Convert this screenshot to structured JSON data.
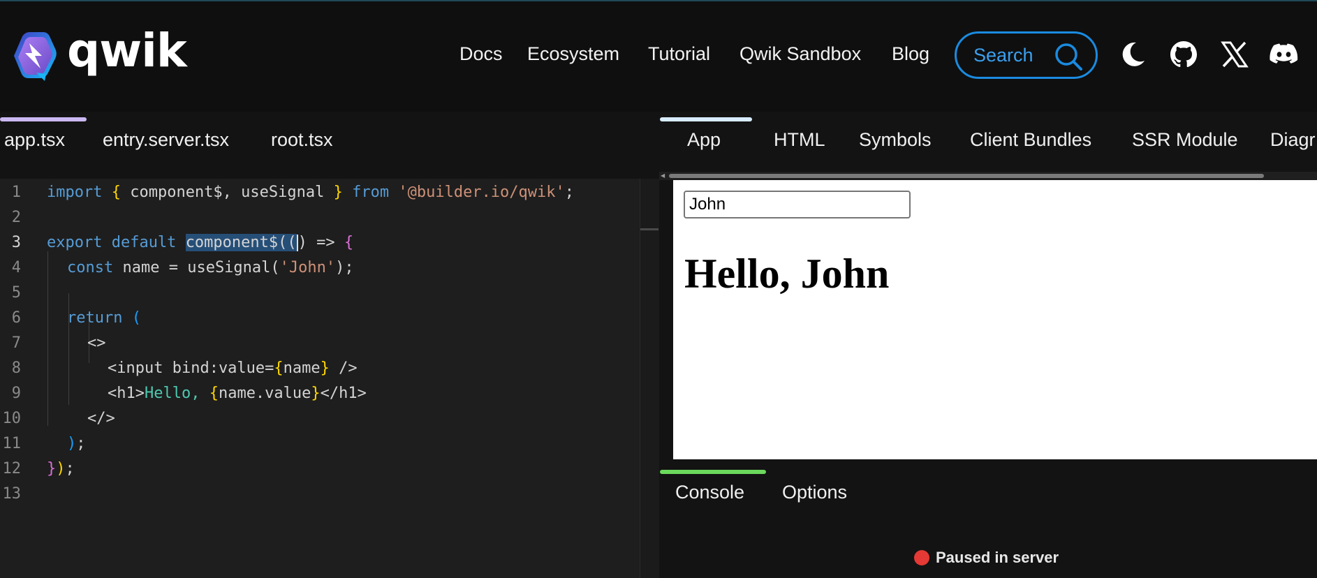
{
  "app": {
    "logo_text": "qwik"
  },
  "nav": {
    "items": [
      "Docs",
      "Ecosystem",
      "Tutorial",
      "Qwik Sandbox",
      "Blog"
    ],
    "search_label": "Search"
  },
  "header_icons": [
    "moon-icon",
    "github-icon",
    "x-icon",
    "discord-icon"
  ],
  "editor": {
    "tabs": [
      "app.tsx",
      "entry.server.tsx",
      "root.tsx"
    ],
    "active_tab": "app.tsx",
    "line_numbers": [
      "1",
      "2",
      "3",
      "4",
      "5",
      "6",
      "7",
      "8",
      "9",
      "10",
      "11",
      "12",
      "13"
    ],
    "active_line": "3",
    "code": {
      "l1_import": "import",
      "l1_ob": "{",
      "l1_names": " component$, useSignal ",
      "l1_cb": "}",
      "l1_from": " from ",
      "l1_str": "'@builder.io/qwik'",
      "l1_semi": ";",
      "l3_export": "export default ",
      "l3_sel": "component$((",
      "l3_rest": ") => ",
      "l3_brace": "{",
      "l4_const": "const",
      "l4_mid": " name = ",
      "l4_fn": "useSignal(",
      "l4_str": "'John'",
      "l4_end": ");",
      "l6_return": "return",
      "l6_paren": " (",
      "l7": "<>",
      "l8_a": "<input bind:value=",
      "l8_b": "{",
      "l8_c": "name",
      "l8_d": "}",
      "l8_e": " />",
      "l9_a": "<h1>",
      "l9_b": "Hello, ",
      "l9_c": "{",
      "l9_d": "name.value",
      "l9_e": "}",
      "l9_f": "</h1>",
      "l10": "</>",
      "l11_paren": ")",
      "l11_semi": ";",
      "l12_a": "}",
      "l12_b": ")",
      "l12_c": ";"
    }
  },
  "preview": {
    "tabs": [
      "App",
      "HTML",
      "Symbols",
      "Client Bundles",
      "SSR Module",
      "Diagr"
    ],
    "active_tab": "App",
    "input_value": "John",
    "heading": "Hello, John"
  },
  "console": {
    "tabs": [
      "Console",
      "Options"
    ],
    "active_tab": "Console",
    "status_text": "Paused in server",
    "status_color": "#e53935"
  },
  "colors": {
    "accent_search": "#1a8be0",
    "editor_tab_indicator": "#cab8f2",
    "preview_tab_indicator": "#d8ecff",
    "console_tab_indicator": "#6bd95c"
  }
}
